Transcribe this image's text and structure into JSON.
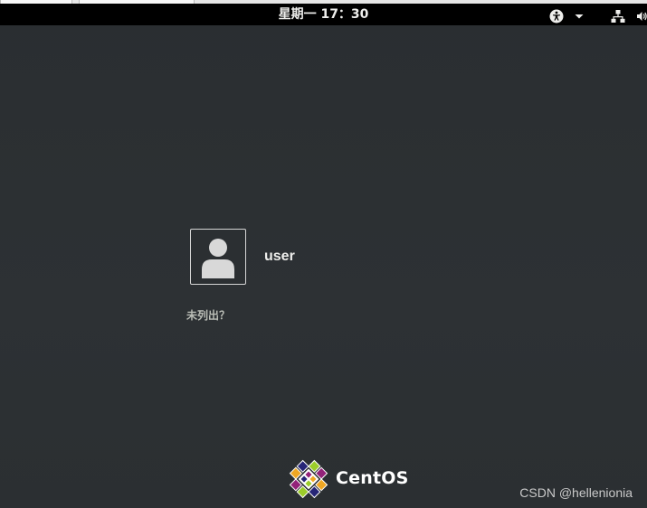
{
  "topbar": {
    "clock": "星期一 17：30",
    "icons": [
      "accessibility-icon",
      "dropdown-arrow-icon",
      "network-icon",
      "volume-icon"
    ]
  },
  "login": {
    "username": "user",
    "not_listed": "未列出？",
    "avatar_icon": "user-avatar-icon"
  },
  "branding": {
    "logo_icon": "centos-logo-icon",
    "name": "CentOS"
  },
  "watermark": "CSDN @hellenionia",
  "colors": {
    "background": "#2b2f32",
    "topbar": "#000000",
    "text": "#eeeeec"
  }
}
